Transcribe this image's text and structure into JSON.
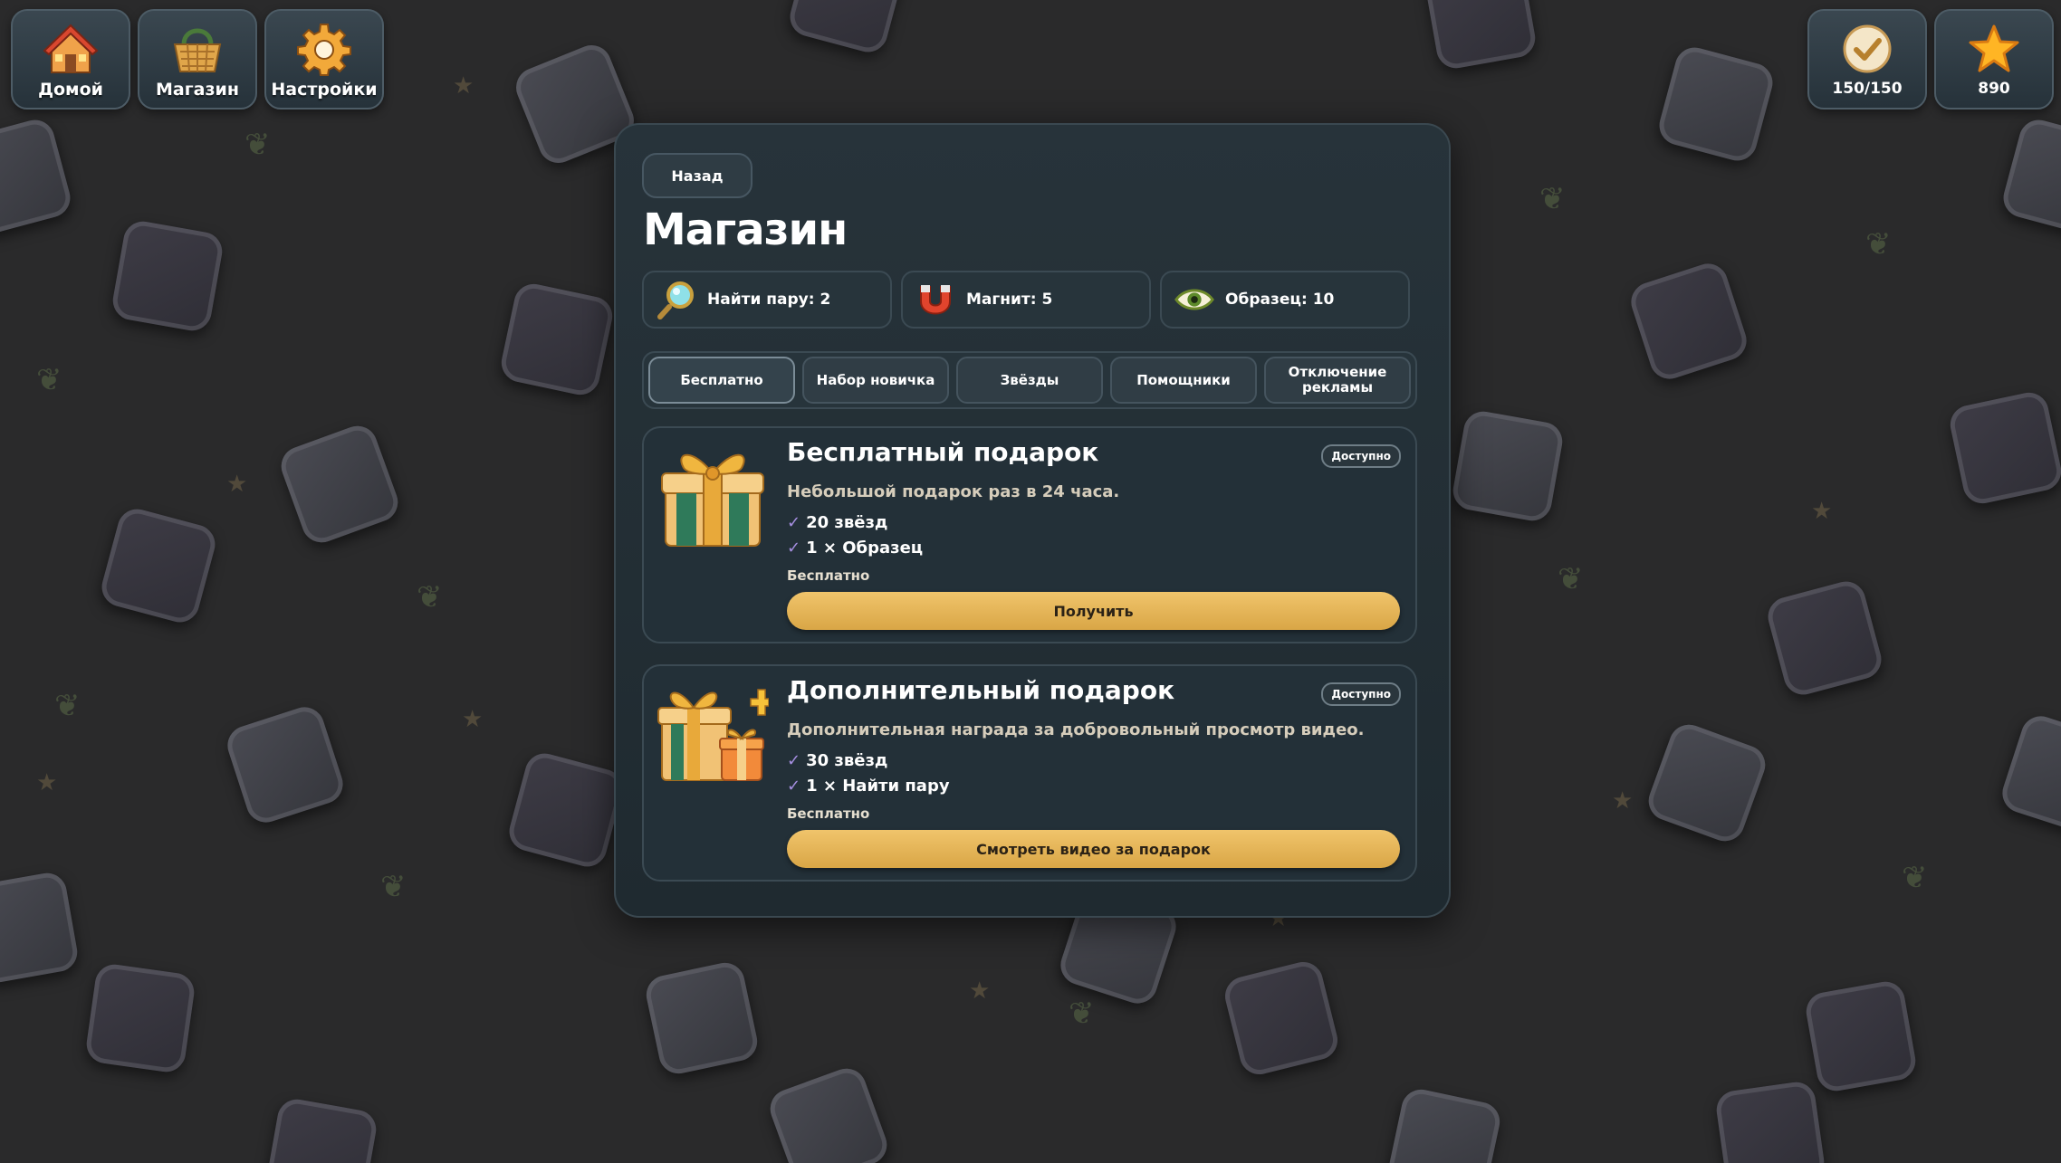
{
  "nav": {
    "home": {
      "label": "Домой",
      "icon": "house-icon"
    },
    "shop": {
      "label": "Магазин",
      "icon": "basket-icon"
    },
    "settings": {
      "label": "Настройки",
      "icon": "gear-icon"
    }
  },
  "stats": {
    "progress": {
      "value": "150/150",
      "icon": "checkmark-icon"
    },
    "stars": {
      "value": "890",
      "icon": "star-icon"
    }
  },
  "panel": {
    "back_label": "Назад",
    "title": "Магазин",
    "boosters": [
      {
        "label": "Найти пару: 2",
        "icon": "magnifier-icon"
      },
      {
        "label": "Магнит: 5",
        "icon": "magnet-icon"
      },
      {
        "label": "Образец: 10",
        "icon": "eye-icon"
      }
    ],
    "tabs": [
      {
        "label": "Бесплатно",
        "active": true
      },
      {
        "label": "Набор новичка"
      },
      {
        "label": "Звёзды"
      },
      {
        "label": "Помощники"
      },
      {
        "label": "Отключение рекламы"
      }
    ],
    "cards": [
      {
        "title": "Бесплатный подарок",
        "description": "Небольшой подарок раз в 24 часа.",
        "rewards": [
          "20 звёзд",
          "1 × Образец"
        ],
        "price": "Бесплатно",
        "badge": "Доступно",
        "button": "Получить",
        "icon": "gift-box-icon"
      },
      {
        "title": "Дополнительный подарок",
        "description": "Дополнительная награда за добровольный просмотр видео.",
        "rewards": [
          "30 звёзд",
          "1 × Найти пару"
        ],
        "price": "Бесплатно",
        "badge": "Доступно",
        "button": "Смотреть видео за подарок",
        "icon": "gifts-plus-icon"
      }
    ]
  },
  "colors": {
    "accent_button": "#e3b358",
    "panel_bg": "#222e35",
    "check_color": "#a58ee0"
  }
}
